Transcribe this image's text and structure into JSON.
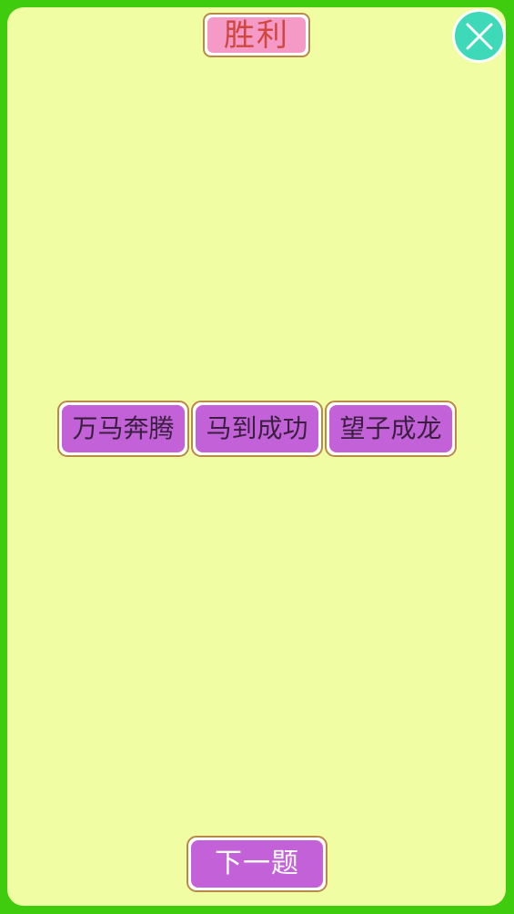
{
  "header": {
    "title": "胜利",
    "close_icon": "close-icon"
  },
  "words": [
    {
      "label": "万马奔腾"
    },
    {
      "label": "马到成功"
    },
    {
      "label": "望子成龙"
    }
  ],
  "footer": {
    "next_label": "下一题"
  },
  "colors": {
    "frame_border": "#3fcc0f",
    "background": "#f1fda3",
    "title_fill": "#f59ac6",
    "title_text": "#d0473e",
    "tile_fill": "#c362d8",
    "tile_border": "#b88a4a",
    "close_fill": "#3ed9b9"
  }
}
